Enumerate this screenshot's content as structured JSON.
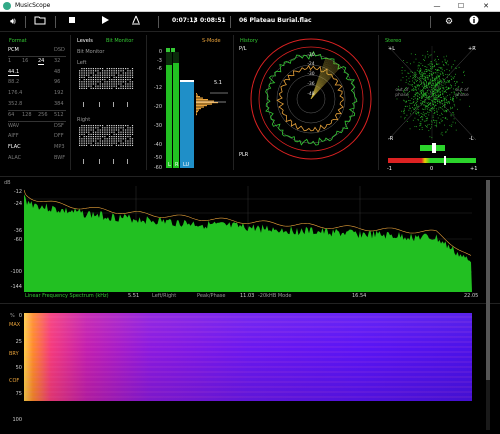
{
  "window": {
    "title": "MusicScope",
    "minimize": "—",
    "maximize": "☐",
    "close": "✕"
  },
  "toolbar": {
    "elapsed": "0:07:13",
    "sep": "/",
    "total": "0:08:51",
    "track": "06 Plateau Burial.flac"
  },
  "format": {
    "title": "Format",
    "rows": [
      [
        "PCM",
        "",
        "DSD"
      ],
      [
        "1",
        "16",
        "24",
        "32"
      ],
      [
        "44.1",
        "",
        "48"
      ],
      [
        "88.2",
        "",
        "96"
      ],
      [
        "176.4",
        "",
        "192"
      ],
      [
        "352.8",
        "",
        "384"
      ],
      [
        "64",
        "128",
        "256",
        "512"
      ],
      [
        "WAV",
        "",
        "DSF"
      ],
      [
        "AIFF",
        "",
        "DFF"
      ],
      [
        "FLAC",
        "",
        "MP3"
      ],
      [
        "ALAC",
        "",
        "BWF"
      ]
    ]
  },
  "levels": {
    "title": "Levels",
    "bitmonitor": "Bit Monitor",
    "left": "Left",
    "right": "Right",
    "l": "L",
    "r": "R",
    "lr": "LU",
    "peak_db": "5.1"
  },
  "smode": {
    "label": "S-Mode"
  },
  "meter": {
    "ticks": [
      "0",
      "-3",
      "-6",
      "-12",
      "-20",
      "-30",
      "-40",
      "-50",
      "-60"
    ]
  },
  "history": {
    "title": "History",
    "pl": "P/L",
    "plr": "PLR",
    "rings": [
      "-30",
      "-24",
      "-30",
      "-36",
      "-48"
    ]
  },
  "stereo": {
    "title": "Stereo",
    "plusL": "+L",
    "plusR": "+R",
    "minusL": "-R",
    "minusR": "-L",
    "outA": "out of phase",
    "outB": "out of phase",
    "corr_left": "-1",
    "corr_mid": "0",
    "corr_right": "+1"
  },
  "spectrum": {
    "db_label": "dB",
    "y_ticks": [
      "-12",
      "-24",
      "-36",
      "-60",
      "-100",
      "-144"
    ],
    "caption": "Linear Frequency Spectrum (kHz)",
    "x_ticks": [
      "5.51",
      "11.03",
      "16.54",
      "22.05"
    ],
    "modes": [
      "Left/Right",
      "Peak/Phase",
      "-20kHB Mode"
    ]
  },
  "spectrogram": {
    "pct": "%",
    "y_ticks": [
      "0",
      "25",
      "50",
      "75",
      "100"
    ],
    "side_labels": [
      "MAX",
      "BRY",
      "COF"
    ]
  },
  "colors": {
    "accent_green": "#34c934",
    "accent_orange": "#e8a23a",
    "meter_blue": "#1f8fc8",
    "panel_bg": "#000000"
  }
}
